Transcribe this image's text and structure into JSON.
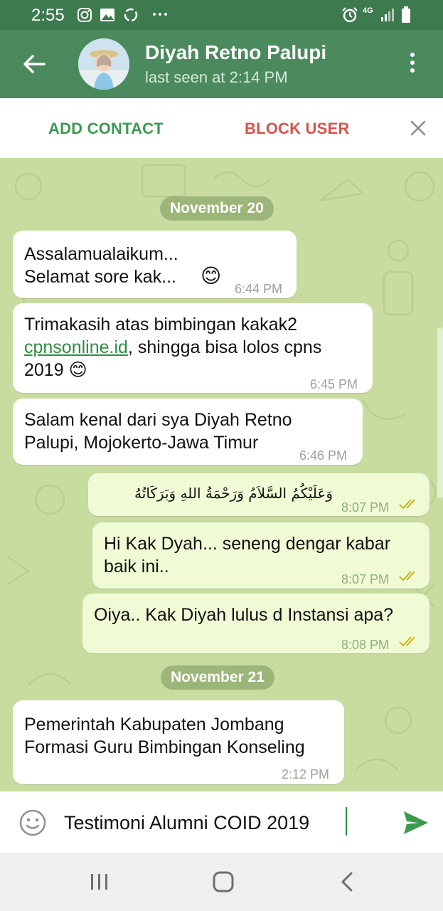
{
  "status_bar": {
    "time": "2:55",
    "network": "4G"
  },
  "header": {
    "name": "Diyah Retno Palupi",
    "last_seen": "last seen at 2:14 PM"
  },
  "action_bar": {
    "add_contact": "ADD CONTACT",
    "block_user": "BLOCK USER"
  },
  "messages": [
    {
      "date": "November 20"
    },
    {
      "dir": "in",
      "lines": [
        "Assalamualaikum...",
        "Selamat sore kak..."
      ],
      "emoji": "😊",
      "time": "6:44 PM"
    },
    {
      "dir": "in",
      "line1": "Trimakasih atas bimbingan kakak2",
      "link": "cpnsonline.id",
      "line2_rest": ", shingga bisa lolos cpns",
      "line3": "2019",
      "emoji": "😊",
      "time": "6:45 PM"
    },
    {
      "dir": "in",
      "lines": [
        "Salam kenal dari sya Diyah Retno",
        "Palupi,  Mojokerto-Jawa Timur"
      ],
      "time": "6:46 PM"
    },
    {
      "dir": "out",
      "text": "وَعَلَيْكُمُ السَّلاَمُ وَرَحْمَةُ اللهِ وَبَرَكَاتُهُ",
      "time": "8:07 PM"
    },
    {
      "dir": "out",
      "lines": [
        "Hi Kak Dyah... seneng dengar kabar",
        "baik ini.."
      ],
      "time": "8:07 PM"
    },
    {
      "dir": "out",
      "text": "Oiya.. Kak Diyah lulus d Instansi apa?",
      "time": "8:08 PM"
    },
    {
      "date": "November 21"
    },
    {
      "dir": "in",
      "lines": [
        "Pemerintah Kabupaten Jombang",
        "Formasi Guru Bimbingan Konseling"
      ],
      "time": "2:12 PM"
    }
  ],
  "composer": {
    "value": "Testimoni Alumni COID 2019"
  },
  "colors": {
    "header": "#4a8a5c",
    "statusbar": "#3d7a4e",
    "chat_bg": "#c8dca0",
    "outgoing": "#f0fbd6",
    "accent": "#2e8f40",
    "block": "#d9534f"
  },
  "icons": [
    "back-arrow-icon",
    "more-vert-icon",
    "close-icon",
    "emoji-icon",
    "send-icon",
    "double-check-icon",
    "instagram-icon",
    "gallery-icon",
    "sync-icon",
    "alarm-icon",
    "signal-icon",
    "battery-icon",
    "nav-recents-icon",
    "nav-home-icon",
    "nav-back-icon"
  ]
}
